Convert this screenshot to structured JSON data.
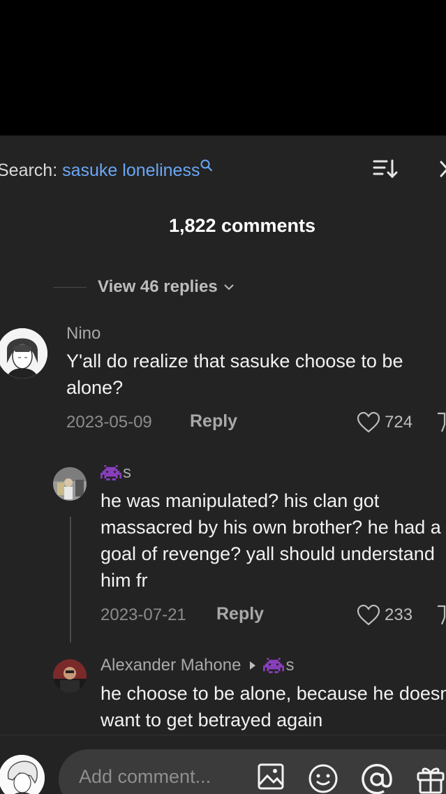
{
  "search": {
    "label": "Search:",
    "term": "sasuke loneliness"
  },
  "comments_count": "1,822 comments",
  "view_replies": "View 46 replies",
  "comments": [
    {
      "author": "Nino",
      "text": "Y'all do realize that sasuke choose to be alone?",
      "date": "2023-05-09",
      "reply_label": "Reply",
      "likes": "724"
    },
    {
      "author": "s",
      "author_prefix_icon": "space-invader-emoji",
      "text": "he was manipulated? his clan got massacred by his own brother? he had a goal of revenge? yall should understand him fr",
      "date": "2023-07-21",
      "reply_label": "Reply",
      "likes": "233"
    },
    {
      "author": "Alexander Mahone",
      "reply_to": "s",
      "text": "he choose to be alone, because he doesn't want to get betrayed again"
    }
  ],
  "composer": {
    "placeholder": "Add comment..."
  },
  "colors": {
    "link": "#6aa7f5",
    "background": "#232323",
    "pill": "#3b3b3b"
  }
}
